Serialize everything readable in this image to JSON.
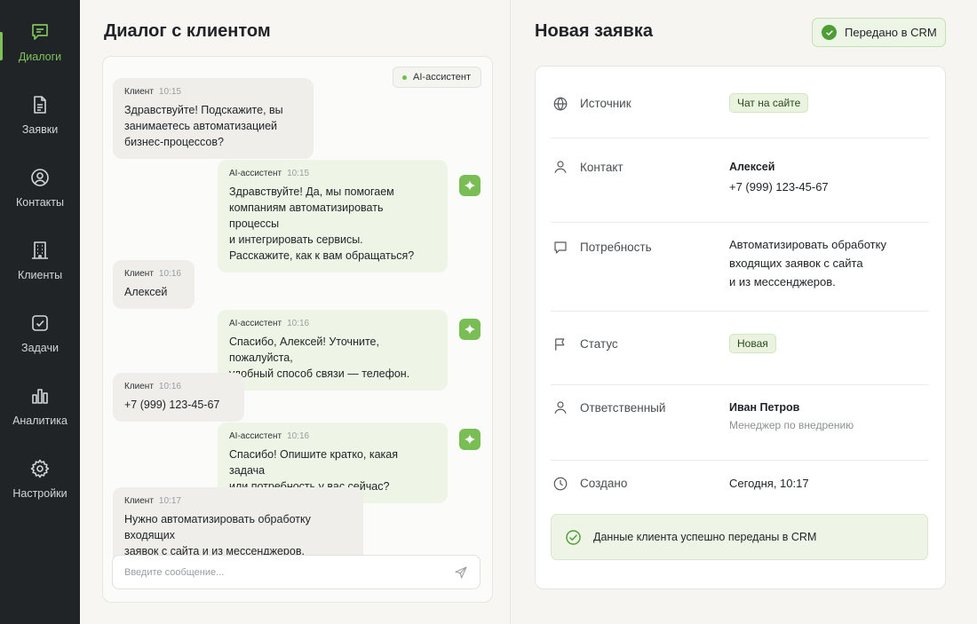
{
  "sidebar": {
    "items": [
      {
        "label": "Диалоги",
        "icon": "chat-icon",
        "active": true
      },
      {
        "label": "Заявки",
        "icon": "document-icon",
        "active": false
      },
      {
        "label": "Контакты",
        "icon": "user-circle-icon",
        "active": false
      },
      {
        "label": "Клиенты",
        "icon": "building-icon",
        "active": false
      },
      {
        "label": "Задачи",
        "icon": "checkbox-icon",
        "active": false
      },
      {
        "label": "Аналитика",
        "icon": "bar-chart-icon",
        "active": false
      },
      {
        "label": "Настройки",
        "icon": "gear-icon",
        "active": false
      }
    ]
  },
  "chat": {
    "title": "Диалог с клиентом",
    "ai_badge": "AI-ассистент",
    "input_placeholder": "Введите сообщение...",
    "messages": [
      {
        "author": "Клиент",
        "time": "10:15",
        "text": "Здравствуйте! Подскажите, вы\nзанимаетесь автоматизацией\nбизнес-процессов?"
      },
      {
        "author": "AI-ассистент",
        "time": "10:15",
        "text": "Здравствуйте! Да, мы помогаем\nкомпаниям автоматизировать процессы\nи интегрировать сервисы.\nРасскажите, как к вам обращаться?"
      },
      {
        "author": "Клиент",
        "time": "10:16",
        "text": "Алексей"
      },
      {
        "author": "AI-ассистент",
        "time": "10:16",
        "text": "Спасибо, Алексей! Уточните, пожалуйста,\nудобный способ связи — телефон."
      },
      {
        "author": "Клиент",
        "time": "10:16",
        "text": "+7 (999) 123-45-67"
      },
      {
        "author": "AI-ассистент",
        "time": "10:16",
        "text": "Спасибо! Опишите кратко, какая задача\nили потребность у вас сейчас?"
      },
      {
        "author": "Клиент",
        "time": "10:17",
        "text": "Нужно автоматизировать обработку входящих\nзаявок с сайта и из мессенджеров."
      }
    ]
  },
  "request": {
    "title": "Новая заявка",
    "crm_button": "Передано в CRM",
    "source": {
      "label": "Источник",
      "value": "Чат на сайте"
    },
    "contact": {
      "label": "Контакт",
      "name": "Алексей",
      "phone": "+7 (999) 123-45-67"
    },
    "need": {
      "label": "Потребность",
      "value": "Автоматизировать обработку\nвходящих заявок с сайта\nи из мессенджеров."
    },
    "status": {
      "label": "Статус",
      "value": "Новая"
    },
    "assignee": {
      "label": "Ответственный",
      "name": "Иван Петров",
      "role": "Менеджер по внедрению"
    },
    "created": {
      "label": "Создано",
      "value": "Сегодня, 10:17"
    },
    "success_message": "Данные клиента успешно переданы в CRM"
  },
  "colors": {
    "sidebar_bg": "#202427",
    "accent": "#78be54",
    "success": "#4e9d35"
  }
}
